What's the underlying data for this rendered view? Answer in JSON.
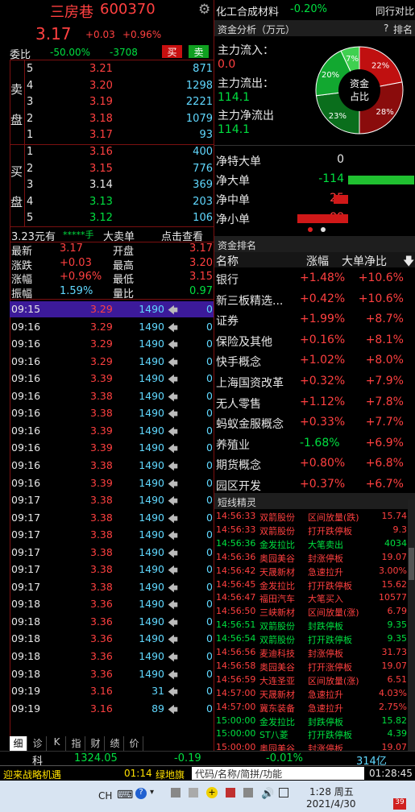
{
  "stock": {
    "name": "三房巷",
    "code": "600370",
    "price": "3.17",
    "change": "+0.03",
    "pct": "+0.96%",
    "weibi_label": "委比",
    "weibi": "-50.00%",
    "weicha": "-3708",
    "buy": "买",
    "sell": "卖"
  },
  "sector": {
    "name": "化工合成材料",
    "pct": "-0.20%",
    "compare": "同行对比"
  },
  "capital": {
    "title": "资金分析（万元）",
    "help": "?",
    "rank_btn": "排名",
    "inflow_label": "主力流入：",
    "inflow": "0.0",
    "outflow_label": "主力流出：",
    "outflow": "114.1",
    "net_label": "主力净流出",
    "net": "114.1",
    "donut_center1": "资金",
    "donut_center2": "占比",
    "slices": [
      {
        "label": "22%",
        "value": 22,
        "color": "#c01010"
      },
      {
        "label": "28%",
        "value": 28,
        "color": "#8a0c0c"
      },
      {
        "label": "23%",
        "value": 23,
        "color": "#0a6e1c"
      },
      {
        "label": "20%",
        "value": 20,
        "color": "#12a830"
      },
      {
        "label": "7%",
        "value": 7,
        "color": "#40d050"
      }
    ]
  },
  "netflows": [
    {
      "label": "净特大单",
      "value": "0",
      "bar": 0,
      "color": "#ffffff"
    },
    {
      "label": "净大单",
      "value": "-114",
      "bar": 1.0,
      "color": "#20c030"
    },
    {
      "label": "净中单",
      "value": "25",
      "bar": 0.22,
      "color": "#d01818"
    },
    {
      "label": "净小单",
      "value": "88",
      "bar": 0.77,
      "color": "#d01818"
    }
  ],
  "sell_label": [
    "卖",
    "盘"
  ],
  "buy_label": [
    "买",
    "盘"
  ],
  "asks": [
    {
      "n": "5",
      "p": "3.21",
      "v": "871",
      "c": "red"
    },
    {
      "n": "4",
      "p": "3.20",
      "v": "1298",
      "c": "red"
    },
    {
      "n": "3",
      "p": "3.19",
      "v": "2221",
      "c": "red"
    },
    {
      "n": "2",
      "p": "3.18",
      "v": "1079",
      "c": "red"
    },
    {
      "n": "1",
      "p": "3.17",
      "v": "93",
      "c": "red"
    }
  ],
  "bids": [
    {
      "n": "1",
      "p": "3.16",
      "v": "400",
      "c": "red"
    },
    {
      "n": "2",
      "p": "3.15",
      "v": "776",
      "c": "red"
    },
    {
      "n": "3",
      "p": "3.14",
      "v": "369",
      "c": "wht"
    },
    {
      "n": "4",
      "p": "3.13",
      "v": "203",
      "c": "grn"
    },
    {
      "n": "5",
      "p": "3.12",
      "v": "106",
      "c": "grn"
    }
  ],
  "bigorder": {
    "price": "3.23元有",
    "stars": "*****手",
    "label": "大卖单",
    "link": "点击查看"
  },
  "stats": [
    {
      "l1": "最新",
      "v1": "3.17",
      "c1": "red",
      "l2": "开盘",
      "v2": "3.17",
      "c2": "red"
    },
    {
      "l1": "涨跌",
      "v1": "+0.03",
      "c1": "red",
      "l2": "最高",
      "v2": "3.20",
      "c2": "red"
    },
    {
      "l1": "涨幅",
      "v1": "+0.96%",
      "c1": "red",
      "l2": "最低",
      "v2": "3.15",
      "c2": "red"
    },
    {
      "l1": "振幅",
      "v1": "1.59%",
      "c1": "cy",
      "l2": "量比",
      "v2": "0.97",
      "c2": "grn"
    }
  ],
  "ticks": [
    [
      "09:15",
      "3.29",
      "1490",
      "0"
    ],
    [
      "09:16",
      "3.29",
      "1490",
      "0"
    ],
    [
      "09:16",
      "3.29",
      "1490",
      "0"
    ],
    [
      "09:16",
      "3.29",
      "1490",
      "0"
    ],
    [
      "09:16",
      "3.39",
      "1490",
      "0"
    ],
    [
      "09:16",
      "3.38",
      "1490",
      "0"
    ],
    [
      "09:16",
      "3.38",
      "1490",
      "0"
    ],
    [
      "09:16",
      "3.39",
      "1490",
      "0"
    ],
    [
      "09:16",
      "3.39",
      "1490",
      "0"
    ],
    [
      "09:16",
      "3.38",
      "1490",
      "0"
    ],
    [
      "09:16",
      "3.39",
      "1490",
      "0"
    ],
    [
      "09:17",
      "3.38",
      "1490",
      "0"
    ],
    [
      "09:17",
      "3.38",
      "1490",
      "0"
    ],
    [
      "09:17",
      "3.38",
      "1490",
      "0"
    ],
    [
      "09:17",
      "3.38",
      "1490",
      "0"
    ],
    [
      "09:17",
      "3.38",
      "1490",
      "0"
    ],
    [
      "09:17",
      "3.38",
      "1490",
      "0"
    ],
    [
      "09:18",
      "3.36",
      "1490",
      "0"
    ],
    [
      "09:18",
      "3.36",
      "1490",
      "0"
    ],
    [
      "09:18",
      "3.36",
      "1490",
      "0"
    ],
    [
      "09:18",
      "3.36",
      "1490",
      "0"
    ],
    [
      "09:18",
      "3.36",
      "1490",
      "0"
    ],
    [
      "09:19",
      "3.16",
      "31",
      "0"
    ],
    [
      "09:19",
      "3.16",
      "89",
      "0"
    ]
  ],
  "ranking": {
    "title": "资金排名",
    "col1": "名称",
    "col2": "涨幅",
    "col3": "大单净比",
    "sort_icon": "arrow-down-icon",
    "rows": [
      [
        "银行",
        "+1.48%",
        "+10.6%"
      ],
      [
        "新三板精选...",
        "+0.42%",
        "+10.6%"
      ],
      [
        "证券",
        "+1.99%",
        "+8.7%"
      ],
      [
        "保险及其他",
        "+0.16%",
        "+8.1%"
      ],
      [
        "快手概念",
        "+1.02%",
        "+8.0%"
      ],
      [
        "上海国资改革",
        "+0.32%",
        "+7.9%"
      ],
      [
        "无人零售",
        "+1.12%",
        "+7.8%"
      ],
      [
        "蚂蚁金服概念",
        "+0.33%",
        "+7.7%"
      ],
      [
        "养殖业",
        "-1.68%",
        "+6.9%"
      ],
      [
        "期货概念",
        "+0.80%",
        "+6.8%"
      ],
      [
        "园区开发",
        "+0.37%",
        "+6.7%"
      ]
    ]
  },
  "shortline": {
    "title": "短线精灵",
    "rows": [
      [
        "14:56:33",
        "双箭股份",
        "区间放量(跌)",
        "15.74"
      ],
      [
        "14:56:33",
        "双箭股份",
        "打开跌停板",
        "9.3"
      ],
      [
        "14:56:36",
        "金发拉比",
        "大笔卖出",
        "4034"
      ],
      [
        "14:56:36",
        "奥园美谷",
        "封涨停板",
        "19.07"
      ],
      [
        "14:56:42",
        "天晟新材",
        "急速拉升",
        "3.00%"
      ],
      [
        "14:56:45",
        "金发拉比",
        "打开跌停板",
        "15.62"
      ],
      [
        "14:56:47",
        "福田汽车",
        "大笔买入",
        "10577"
      ],
      [
        "14:56:50",
        "三峡新材",
        "区间放量(涨)",
        "6.79"
      ],
      [
        "14:56:51",
        "双箭股份",
        "封跌停板",
        "9.35"
      ],
      [
        "14:56:54",
        "双箭股份",
        "打开跌停板",
        "9.35"
      ],
      [
        "14:56:56",
        "麦迪科技",
        "封涨停板",
        "31.73"
      ],
      [
        "14:56:58",
        "奥园美谷",
        "打开涨停板",
        "19.07"
      ],
      [
        "14:56:59",
        "大连圣亚",
        "区间放量(涨)",
        "6.51"
      ],
      [
        "14:57:00",
        "天晟新材",
        "急速拉升",
        "4.03%"
      ],
      [
        "14:57:00",
        "冀东装备",
        "急速拉升",
        "2.75%"
      ],
      [
        "15:00:00",
        "金发拉比",
        "封跌停板",
        "15.82"
      ],
      [
        "15:00:00",
        "ST八菱",
        "打开跌停板",
        "4.39"
      ],
      [
        "15:00:00",
        "奥园美谷",
        "封涨停板",
        "19.07"
      ]
    ],
    "colors": [
      "red",
      "red",
      "grn",
      "red",
      "red",
      "red",
      "red",
      "red",
      "grn",
      "grn",
      "red",
      "red",
      "red",
      "red",
      "red",
      "grn",
      "grn",
      "red"
    ]
  },
  "tabs": [
    "细",
    "诊",
    "K",
    "指",
    "财",
    "绩",
    "价"
  ],
  "index": {
    "label": "科",
    "value": "1324.05",
    "change": "-0.19",
    "pct": "-0.01%",
    "amount": "314亿"
  },
  "statusbar": {
    "ticker": "迎来战略机遇",
    "time": "01:14",
    "tag": "绿地旗",
    "search": "代码/名称/简拼/功能",
    "clock": "01:28:45"
  },
  "taskbar": {
    "lang": "CH",
    "time": "1:28 周五",
    "date": "2021/4/30",
    "badge": "39"
  }
}
